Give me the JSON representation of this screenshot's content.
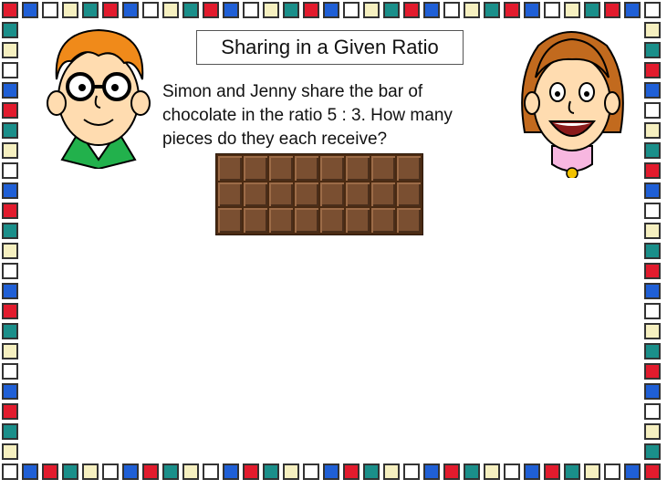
{
  "title": "Sharing in a Given Ratio",
  "question": "Simon and Jenny share the bar of chocolate in the ratio 5 : 3. How many pieces do they each receive?",
  "chocolate": {
    "rows": 3,
    "columns": 8
  },
  "border_colors": [
    "#e21b2d",
    "#1f5fd6",
    "#ffffff",
    "#f6f0c0",
    "#1a8f8a"
  ]
}
